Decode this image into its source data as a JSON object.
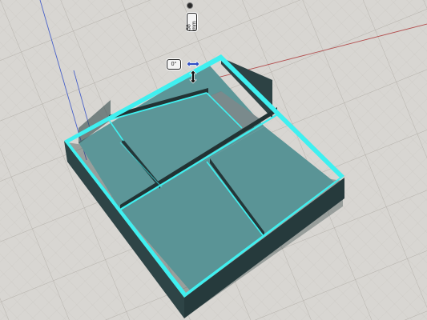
{
  "viewport": {
    "background": "#d8d6d2",
    "grid_color": "#bdbab5",
    "x_axis_color": "#b35050",
    "y_axis_color": "#4a62c8"
  },
  "model": {
    "selection_color": "#3ff0f0",
    "inner_floor_color": "#5c9698",
    "wall_outer_color": "#2f4749",
    "wall_top_color": "#3a5a5c"
  },
  "badges": {
    "angle": "0°",
    "length": "58 mm"
  },
  "icons": {
    "move_arrows": "double-arrow-horizontal",
    "resize_arrows": "double-arrow-vertical",
    "origin_pin": "pin"
  }
}
